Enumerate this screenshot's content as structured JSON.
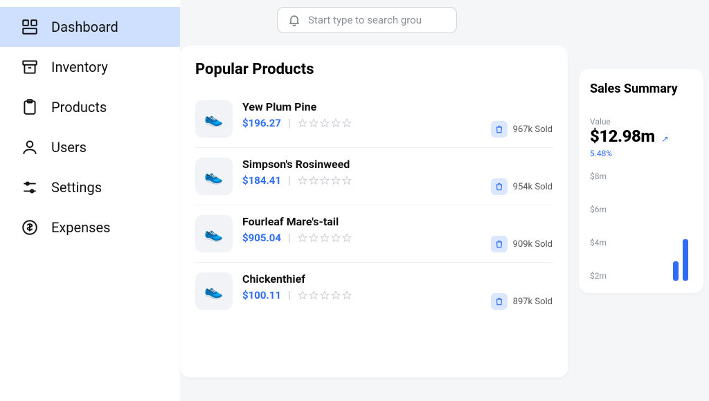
{
  "sidebar": {
    "items": [
      {
        "label": "Dashboard"
      },
      {
        "label": "Inventory"
      },
      {
        "label": "Products"
      },
      {
        "label": "Users"
      },
      {
        "label": "Settings"
      },
      {
        "label": "Expenses"
      }
    ]
  },
  "search": {
    "placeholder": "Start type to search grou"
  },
  "popular": {
    "title": "Popular Products",
    "items": [
      {
        "name": "Yew Plum Pine",
        "price": "$196.27",
        "sold": "967k Sold"
      },
      {
        "name": "Simpson's Rosinweed",
        "price": "$184.41",
        "sold": "954k Sold"
      },
      {
        "name": "Fourleaf Mare's-tail",
        "price": "$905.04",
        "sold": "909k Sold"
      },
      {
        "name": "Chickenthief",
        "price": "$100.11",
        "sold": "897k Sold"
      }
    ]
  },
  "summary": {
    "title": "Sales Summary",
    "metric_label": "Value",
    "metric_value": "$12.98m",
    "metric_change": "5.48%",
    "y_ticks": [
      "$8m",
      "$6m",
      "$4m",
      "$2m"
    ]
  }
}
